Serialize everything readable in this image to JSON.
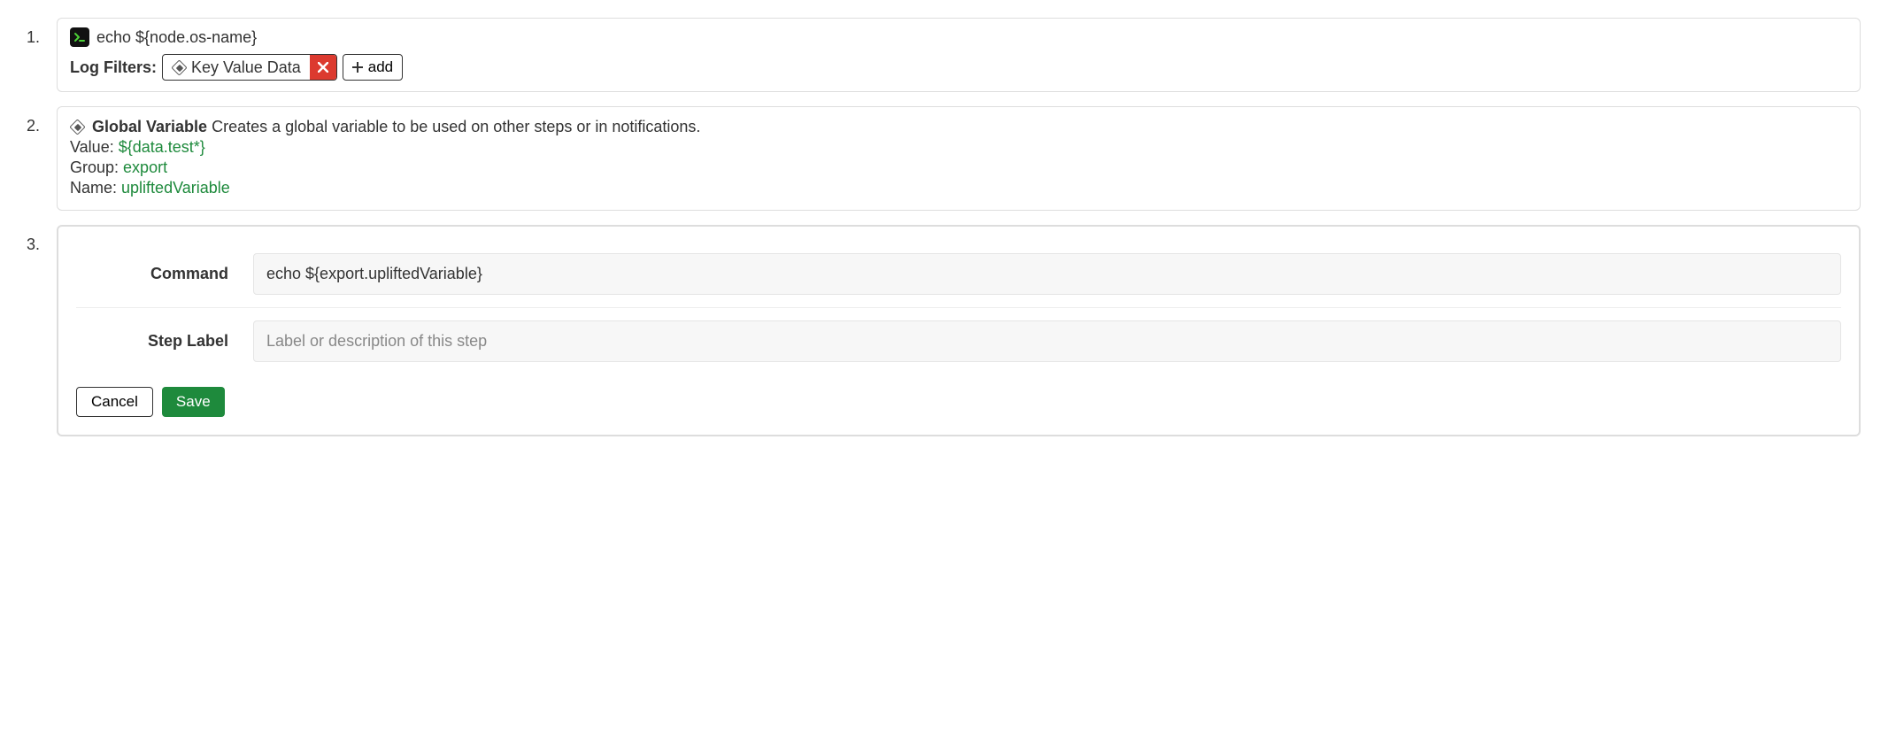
{
  "step1": {
    "command": "echo ${node.os-name}",
    "log_filters_label": "Log Filters:",
    "filter_chip": "Key Value Data",
    "add_label": "add"
  },
  "step2": {
    "title": "Global Variable",
    "description": "Creates a global variable to be used on other steps or in notifications.",
    "value_label": "Value:",
    "value": "${data.test*}",
    "group_label": "Group:",
    "group": "export",
    "name_label": "Name:",
    "name": "upliftedVariable"
  },
  "step3": {
    "command_label": "Command",
    "command_value": "echo ${export.upliftedVariable}",
    "step_label_label": "Step Label",
    "step_label_placeholder": "Label or description of this step",
    "step_label_value": "",
    "cancel_label": "Cancel",
    "save_label": "Save"
  }
}
